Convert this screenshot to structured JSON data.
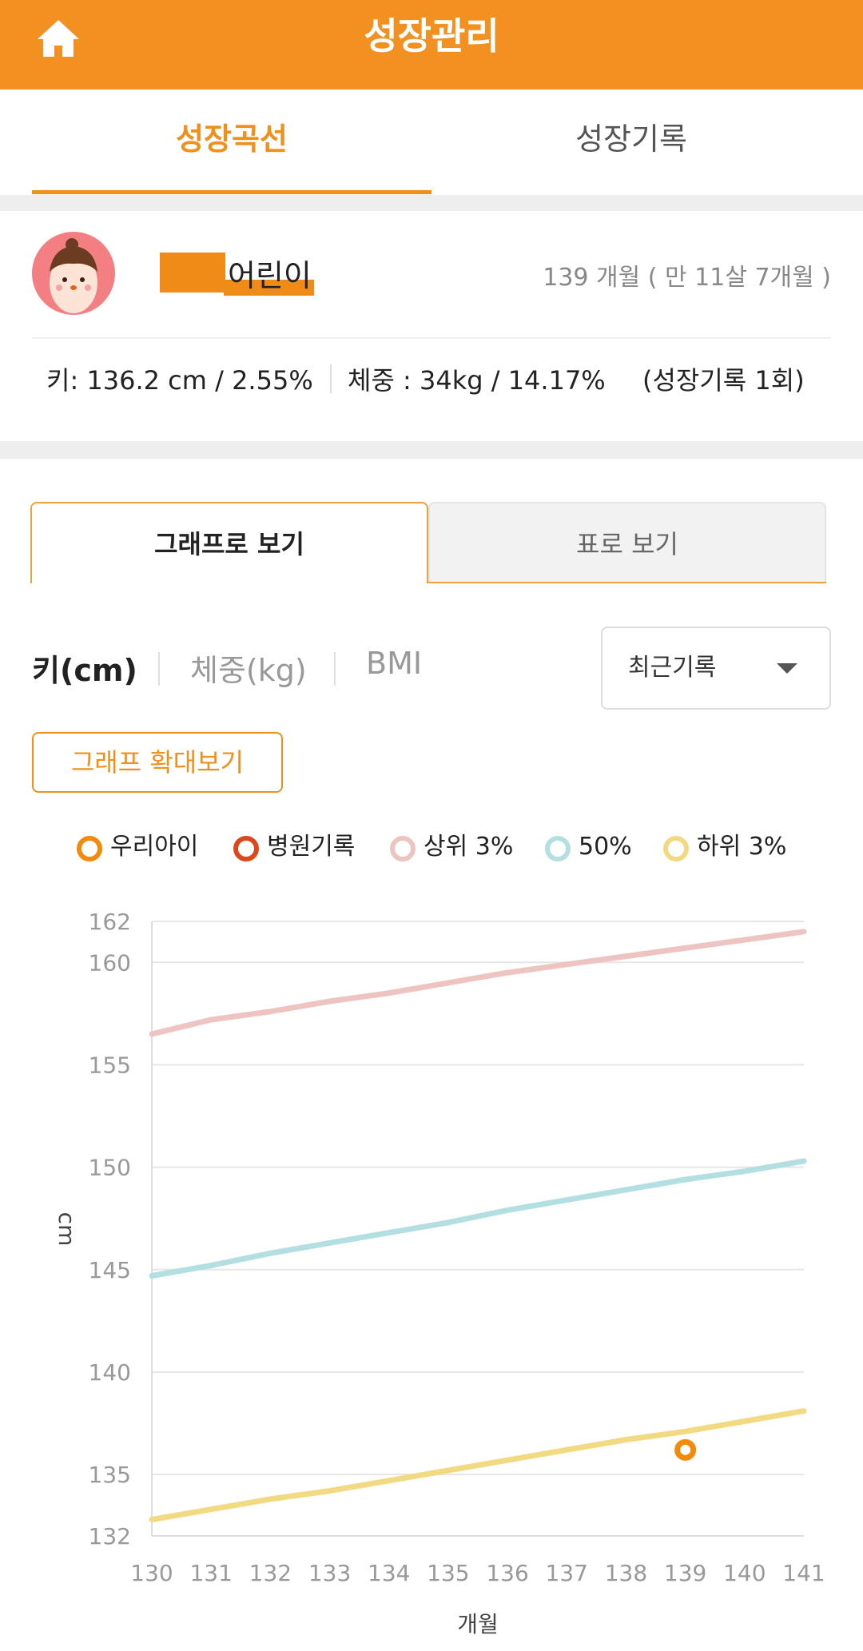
{
  "header": {
    "title": "성장관리",
    "home_icon": "home-icon"
  },
  "tabs": [
    {
      "label": "성장곡선",
      "active": true
    },
    {
      "label": "성장기록",
      "active": false
    }
  ],
  "profile": {
    "name_suffix": "어린이",
    "age_text": "139 개월 ( 만 11살 7개월 )",
    "height_stat": "키: 136.2 cm / 2.55%",
    "weight_stat": "체중 : 34kg / 14.17%",
    "record_count": "(성장기록 1회)"
  },
  "view_tabs": [
    {
      "label": "그래프로 보기",
      "active": true
    },
    {
      "label": "표로 보기",
      "active": false
    }
  ],
  "metric_tabs": [
    {
      "label": "키(cm)",
      "active": true
    },
    {
      "label": "체중(kg)",
      "active": false
    },
    {
      "label": "BMI",
      "active": false
    }
  ],
  "filter": {
    "selected": "최근기록"
  },
  "zoom_button": "그래프 확대보기",
  "legend": [
    {
      "label": "우리아이",
      "color": "#f28a0c"
    },
    {
      "label": "병원기록",
      "color": "#e0461b"
    },
    {
      "label": "상위 3%",
      "color": "#edc4c2"
    },
    {
      "label": "50%",
      "color": "#b3dfe2"
    },
    {
      "label": "하위 3%",
      "color": "#f2da83"
    }
  ],
  "chart_data": {
    "type": "line",
    "xlabel": "개월",
    "ylabel": "cm",
    "x": [
      130,
      131,
      132,
      133,
      134,
      135,
      136,
      137,
      138,
      139,
      140,
      141
    ],
    "xlim": [
      130,
      141
    ],
    "ylim": [
      132,
      162
    ],
    "yticks": [
      132,
      135,
      140,
      145,
      150,
      155,
      160,
      162
    ],
    "grid": true,
    "series": [
      {
        "name": "상위 3%",
        "color": "#edc4c2",
        "values": [
          156.5,
          157.2,
          157.6,
          158.1,
          158.5,
          159.0,
          159.5,
          159.9,
          160.3,
          160.7,
          161.1,
          161.5
        ]
      },
      {
        "name": "50%",
        "color": "#b3dfe2",
        "values": [
          144.7,
          145.2,
          145.8,
          146.3,
          146.8,
          147.3,
          147.9,
          148.4,
          148.9,
          149.4,
          149.8,
          150.3
        ]
      },
      {
        "name": "하위 3%",
        "color": "#f2da83",
        "values": [
          132.8,
          133.3,
          133.8,
          134.2,
          134.7,
          135.2,
          135.7,
          136.2,
          136.7,
          137.1,
          137.6,
          138.1
        ]
      }
    ],
    "points": [
      {
        "name": "우리아이",
        "color": "#f28a0c",
        "x": 139,
        "y": 136.2
      }
    ]
  }
}
